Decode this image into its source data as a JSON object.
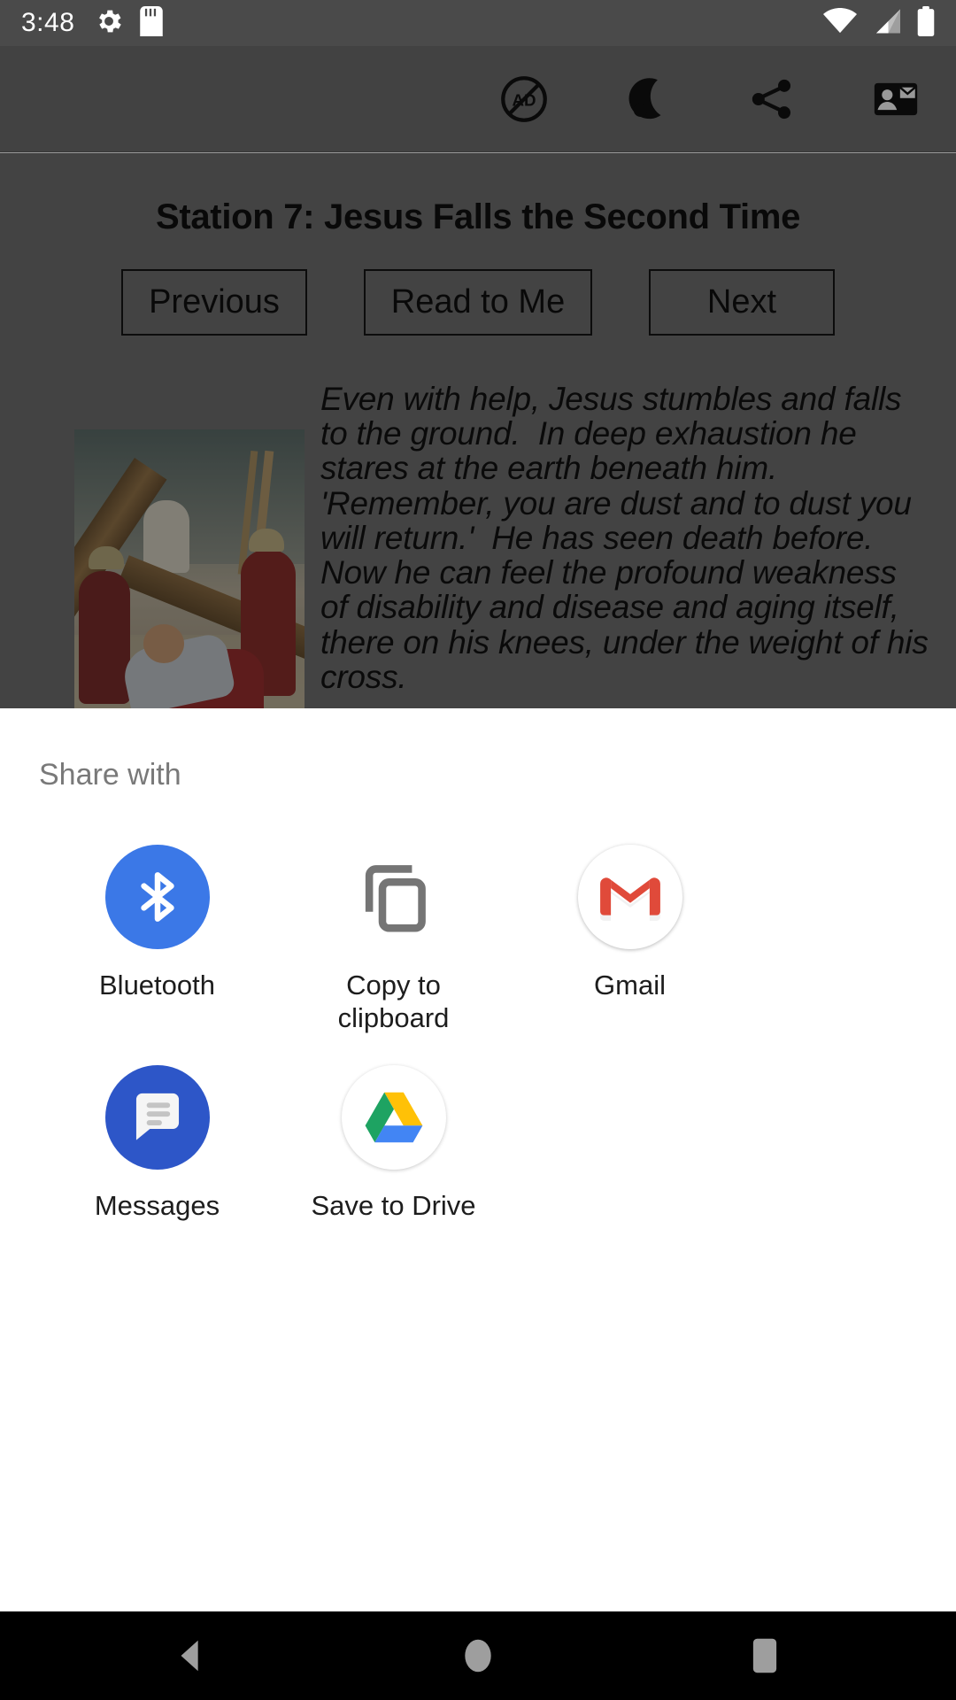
{
  "status_bar": {
    "time": "3:48",
    "left_icons": [
      "settings-gear-icon",
      "sd-card-icon"
    ],
    "right_icons": [
      "wifi-icon",
      "cell-signal-icon",
      "battery-icon"
    ]
  },
  "app_bar": {
    "icons": [
      {
        "name": "no-ads-icon",
        "label": "AD"
      },
      {
        "name": "night-mode-icon",
        "label": ""
      },
      {
        "name": "share-icon",
        "label": ""
      },
      {
        "name": "contact-card-icon",
        "label": ""
      }
    ]
  },
  "page": {
    "title": "Station 7: Jesus Falls the Second Time",
    "buttons": [
      {
        "label": "Previous",
        "name": "previous-button"
      },
      {
        "label": "Read to Me",
        "name": "read-to-me-button"
      },
      {
        "label": "Next",
        "name": "next-button"
      }
    ],
    "story_text": "Even with help, Jesus stumbles and falls to the ground.  In deep exhaustion he stares at the earth beneath him.  'Remember, you are dust and to dust you will return.'  He has seen death before.  Now he can feel the profound weakness of disability and disease and aging itself, there on his knees, under the weight of his cross.",
    "image_alt": "Station 7 painting: Jesus falls beneath the cross"
  },
  "share_sheet": {
    "title": "Share with",
    "targets": [
      {
        "label": "Bluetooth",
        "icon": "bluetooth-icon",
        "color": "#3B78E7"
      },
      {
        "label": "Copy to clipboard",
        "icon": "copy-to-clipboard-icon",
        "color": "#757575"
      },
      {
        "label": "Gmail",
        "icon": "gmail-icon",
        "color": "#EA4335"
      },
      {
        "label": "Messages",
        "icon": "messages-icon",
        "color": "#2D56C8"
      },
      {
        "label": "Save to Drive",
        "icon": "google-drive-icon",
        "color": "#FFC107"
      }
    ]
  },
  "nav_bar": {
    "items": [
      {
        "name": "back-button",
        "icon": "triangle-back-icon"
      },
      {
        "name": "home-button",
        "icon": "circle-home-icon"
      },
      {
        "name": "recents-button",
        "icon": "square-recents-icon"
      }
    ]
  }
}
